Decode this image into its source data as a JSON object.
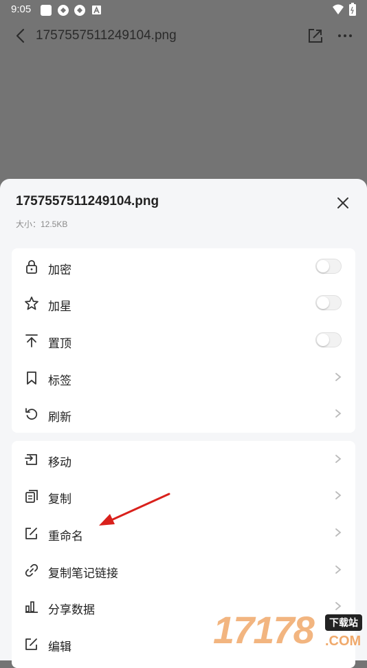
{
  "status_bar": {
    "time": "9:05"
  },
  "header": {
    "title": "1757557511249104.png"
  },
  "sheet": {
    "title": "1757557511249104.png",
    "size_text": "大小：12.5KB",
    "group1": [
      {
        "label": "加密",
        "icon": "lock-icon",
        "control": "toggle",
        "on": false
      },
      {
        "label": "加星",
        "icon": "star-icon",
        "control": "toggle",
        "on": false
      },
      {
        "label": "置顶",
        "icon": "pin-top-icon",
        "control": "toggle",
        "on": false
      },
      {
        "label": "标签",
        "icon": "bookmark-icon",
        "control": "chevron"
      },
      {
        "label": "刷新",
        "icon": "refresh-icon",
        "control": "chevron"
      }
    ],
    "group2": [
      {
        "label": "移动",
        "icon": "move-icon"
      },
      {
        "label": "复制",
        "icon": "copy-icon"
      },
      {
        "label": "重命名",
        "icon": "rename-icon"
      },
      {
        "label": "复制笔记链接",
        "icon": "link-icon"
      },
      {
        "label": "分享数据",
        "icon": "stats-icon"
      },
      {
        "label": "编辑",
        "icon": "edit-icon"
      }
    ]
  },
  "annotation": {
    "arrow_color": "#d9211c"
  },
  "watermark": {
    "number": "17178",
    "badge": "下载站",
    "suffix": ".COM"
  }
}
